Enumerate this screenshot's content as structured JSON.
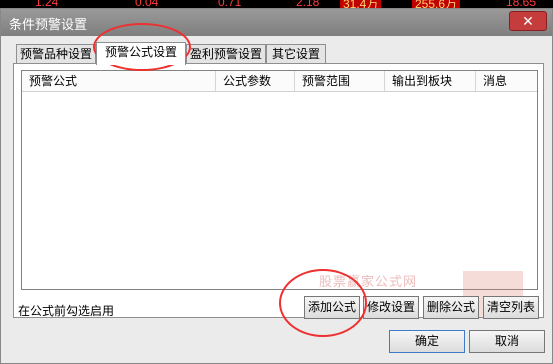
{
  "ticker": [
    "1.24",
    "0.04",
    "0.71",
    "2.18",
    "31.4万",
    "255.6万",
    "18.65"
  ],
  "window": {
    "title": "条件预警设置",
    "close_icon": "close-icon"
  },
  "tabs": [
    "预警品种设置",
    "预警公式设置",
    "盈利预警设置",
    "其它设置"
  ],
  "active_tab": 1,
  "table": {
    "columns": [
      "预警公式",
      "公式参数",
      "预警范围",
      "输出到板块",
      "消息"
    ]
  },
  "hint": "在公式前勾选启用",
  "buttons": {
    "add": "添加公式",
    "modify": "修改设置",
    "delete": "删除公式",
    "clear": "清空列表"
  },
  "footer": {
    "ok": "确定",
    "cancel": "取消"
  },
  "watermark": "股票赢家公式网",
  "colors": {
    "titlebar": "#8c8c8c",
    "close": "#c43c3c",
    "annotation": "#ee3030"
  }
}
